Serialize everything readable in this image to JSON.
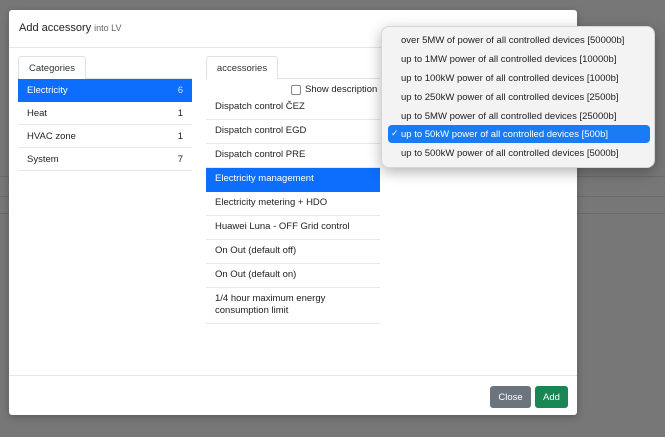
{
  "modal": {
    "title": "Add accessory",
    "subtitle": "into LV"
  },
  "categories": {
    "tab_label": "Categories",
    "items": [
      {
        "label": "Electricity",
        "count": "6",
        "active": true
      },
      {
        "label": "Heat",
        "count": "1"
      },
      {
        "label": "HVAC zone",
        "count": "1"
      },
      {
        "label": "System",
        "count": "7"
      }
    ]
  },
  "accessories": {
    "tab_label": "accessories",
    "show_description_label": "Show description",
    "items": [
      {
        "label": "Dispatch control ČEZ"
      },
      {
        "label": "Dispatch control EGD"
      },
      {
        "label": "Dispatch control PRE"
      },
      {
        "label": "Electricity management",
        "active": true
      },
      {
        "label": "Electricity metering + HDO"
      },
      {
        "label": "Huawei Luna - OFF Grid control"
      },
      {
        "label": "On Out (default off)"
      },
      {
        "label": "On Out (default on)"
      },
      {
        "label": "1/4 hour maximum energy consumption limit"
      }
    ]
  },
  "footer": {
    "close_label": "Close",
    "add_label": "Add"
  },
  "dropdown": {
    "options": [
      {
        "label": "over 5MW of power of all controlled devices [50000b]"
      },
      {
        "label": "up to 1MW power of all controlled devices [10000b]"
      },
      {
        "label": "up to 100kW power of all controlled devices [1000b]"
      },
      {
        "label": "up to 250kW power of all controlled devices [2500b]"
      },
      {
        "label": "up to 5MW power of all controlled devices [25000b]"
      },
      {
        "label": "up to 50kW power of all controlled devices [500b]",
        "selected": true
      },
      {
        "label": "up to 500kW power of all controlled devices [5000b]"
      }
    ],
    "check_glyph": "✓"
  }
}
